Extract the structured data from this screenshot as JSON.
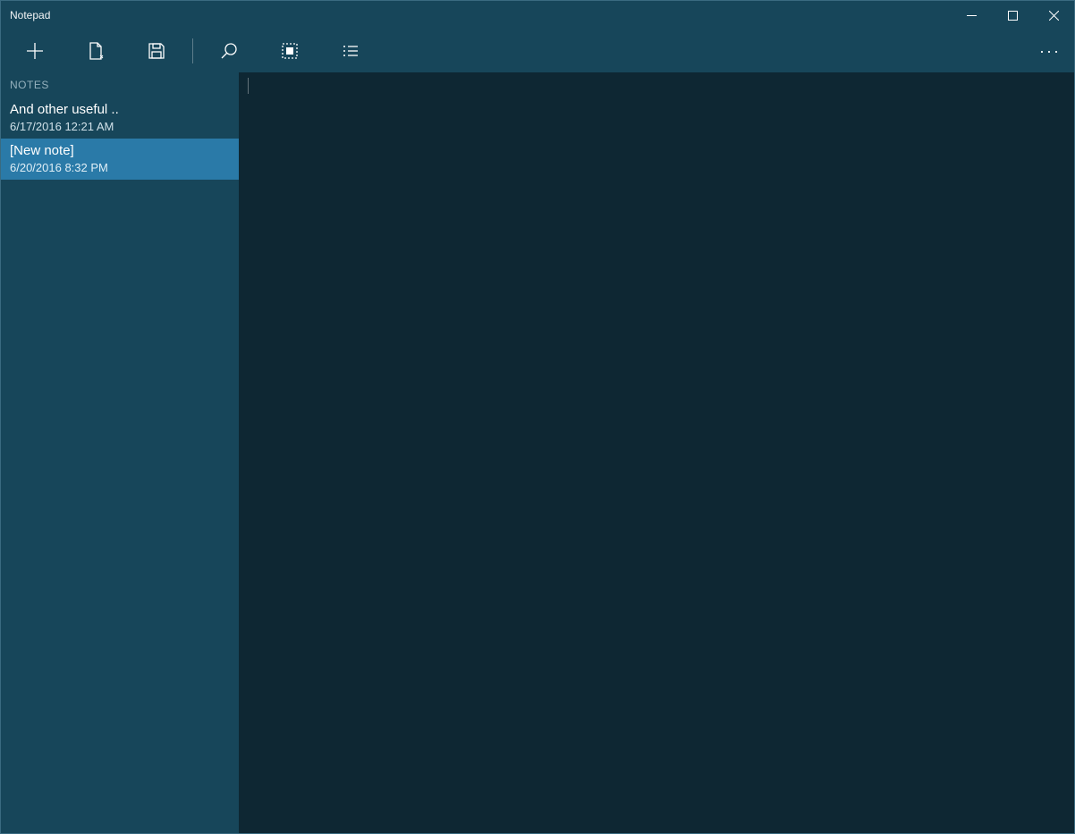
{
  "window": {
    "title": "Notepad"
  },
  "toolbar": {
    "new": "new-note",
    "open": "open-file",
    "save": "save-file",
    "search": "search",
    "selectall": "select-all",
    "list": "list-view",
    "more": "more"
  },
  "sidebar": {
    "header": "NOTES",
    "items": [
      {
        "title": "And other useful ..",
        "date": "6/17/2016 12:21 AM",
        "selected": false
      },
      {
        "title": "[New note]",
        "date": "6/20/2016 8:32 PM",
        "selected": true
      }
    ]
  },
  "editor": {
    "content": ""
  }
}
